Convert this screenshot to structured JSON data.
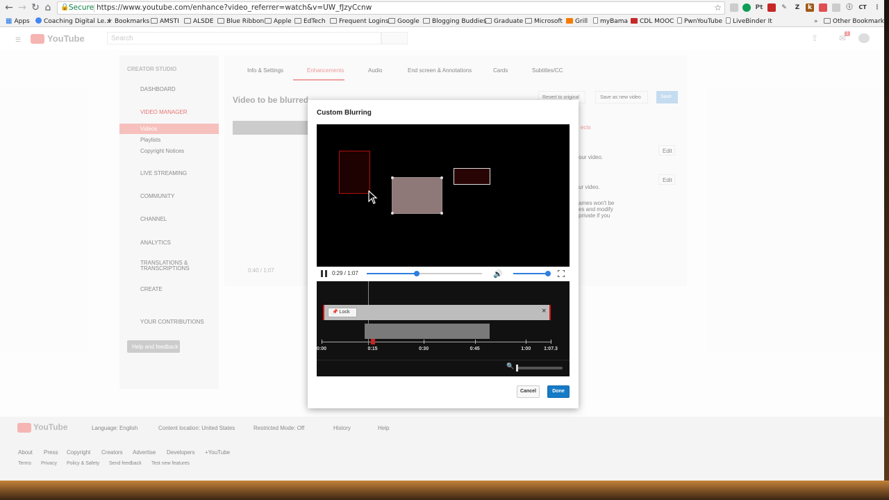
{
  "browser": {
    "secure_label": "Secure",
    "url": "https://www.youtube.com/enhance?video_referrer=watch&v=UW_fJzyCcnw",
    "profile_initials": "CT",
    "extensions": [
      {
        "label": "Pt",
        "color": "#888888"
      },
      {
        "label": "Z",
        "color": "#444444"
      },
      {
        "label": "k",
        "color": "#a05a18"
      }
    ]
  },
  "bookmarks": [
    {
      "label": "Apps",
      "icon": "apps-grid-icon"
    },
    {
      "label": "Coaching Digital Le...",
      "icon": "google-icon"
    },
    {
      "label": "Bookmarks",
      "icon": "star-icon"
    },
    {
      "label": "AMSTI",
      "icon": "folder-icon"
    },
    {
      "label": "ALSDE",
      "icon": "folder-icon"
    },
    {
      "label": "Blue Ribbon",
      "icon": "folder-icon"
    },
    {
      "label": "Apple",
      "icon": "folder-icon"
    },
    {
      "label": "EdTech",
      "icon": "folder-icon"
    },
    {
      "label": "Frequent Logins",
      "icon": "folder-icon"
    },
    {
      "label": "Google",
      "icon": "folder-icon"
    },
    {
      "label": "Blogging Buddies",
      "icon": "folder-icon"
    },
    {
      "label": "Graduate",
      "icon": "folder-icon"
    },
    {
      "label": "Microsoft",
      "icon": "folder-icon"
    },
    {
      "label": "Grill",
      "icon": "blogger-icon"
    },
    {
      "label": "myBama",
      "icon": "file-icon"
    },
    {
      "label": "CDL MOOC",
      "icon": "red-logo-icon"
    },
    {
      "label": "PwnYouTube",
      "icon": "file-icon"
    },
    {
      "label": "LiveBinder It",
      "icon": "file-icon"
    },
    {
      "label": "Other Bookmarks",
      "icon": "folder-icon"
    }
  ],
  "youtube": {
    "logo_text": "YouTube",
    "search_placeholder": "Search",
    "notification_count": "1"
  },
  "studio": {
    "title": "CREATOR STUDIO",
    "sidebar": [
      {
        "label": "DASHBOARD"
      },
      {
        "label": "VIDEO MANAGER"
      },
      {
        "label": "Videos"
      },
      {
        "label": "Playlists"
      },
      {
        "label": "Copyright Notices"
      },
      {
        "label": "LIVE STREAMING"
      },
      {
        "label": "COMMUNITY"
      },
      {
        "label": "CHANNEL"
      },
      {
        "label": "ANALYTICS"
      },
      {
        "label": "TRANSLATIONS & TRANSCRIPTIONS"
      },
      {
        "label": "CREATE"
      },
      {
        "label": "YOUR CONTRIBUTIONS"
      }
    ],
    "help_button": "Help and feedback",
    "tabs": [
      {
        "label": "Info & Settings"
      },
      {
        "label": "Enhancements"
      },
      {
        "label": "Audio"
      },
      {
        "label": "End screen & Annotations"
      },
      {
        "label": "Cards"
      },
      {
        "label": "Subtitles/CC"
      }
    ],
    "video_title": "Video to be blurred",
    "revert_button": "Revert to original",
    "save_new_button": "Save as new video",
    "save_button": "Save",
    "effects_tab": "ects",
    "edit_label": "Edit",
    "right_text": [
      "our video.",
      "ur video.",
      "ames won't be",
      "es and modify",
      "private if you"
    ],
    "bg_player_time": "0:40 / 1:07"
  },
  "footer": {
    "language": "Language: English",
    "location": "Content location: United States",
    "restricted": "Restricted Mode: Off",
    "history": "History",
    "help": "Help",
    "links": [
      "About",
      "Press",
      "Copyright",
      "Creators",
      "Advertise",
      "Developers",
      "+YouTube"
    ],
    "links2": [
      "Terms",
      "Privacy",
      "Policy & Safety",
      "Send feedback",
      "Test new features"
    ]
  },
  "modal": {
    "title": "Custom Blurring",
    "player": {
      "time_display": "0:29 / 1:07",
      "progress_fraction": 0.433,
      "volume_fraction": 1.0
    },
    "timeline": {
      "lock_label": "Lock",
      "tick_labels": [
        "0:00",
        "0:15",
        "0:30",
        "0:45",
        "1:00",
        "1:07.3"
      ],
      "tick_seconds": [
        0,
        15,
        30,
        45,
        60,
        67.3
      ],
      "duration_seconds": 67.3,
      "playhead_seconds": 15
    },
    "cancel_label": "Cancel",
    "done_label": "Done"
  },
  "colors": {
    "accent_blue": "#167ac6",
    "blur_outline_red": "#b01010",
    "youtube_red": "#e62117"
  }
}
